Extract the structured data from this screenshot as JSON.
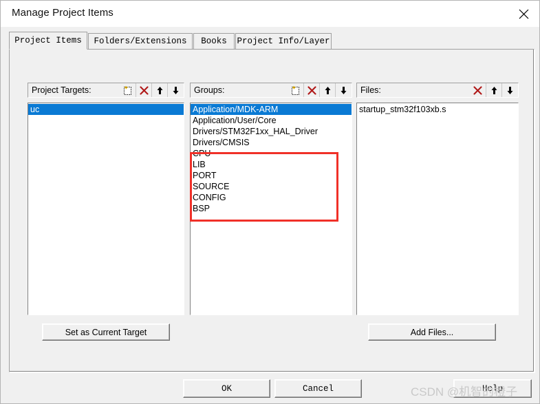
{
  "window": {
    "title": "Manage Project Items",
    "close_icon": "close-icon"
  },
  "tabs": [
    {
      "label": "Project Items",
      "active": true
    },
    {
      "label": "Folders/Extensions",
      "active": false
    },
    {
      "label": "Books",
      "active": false
    },
    {
      "label": "Project Info/Layer",
      "active": false
    }
  ],
  "panels": {
    "targets": {
      "header": "Project Targets:",
      "icons": [
        "new-item-icon",
        "delete-icon",
        "move-up-icon",
        "move-down-icon"
      ],
      "items": [
        {
          "label": "uc",
          "selected": true
        }
      ],
      "button": "Set as Current Target"
    },
    "groups": {
      "header": "Groups:",
      "icons": [
        "new-item-icon",
        "delete-icon",
        "move-up-icon",
        "move-down-icon"
      ],
      "items": [
        {
          "label": "Application/MDK-ARM",
          "selected": true
        },
        {
          "label": "Application/User/Core",
          "selected": false
        },
        {
          "label": "Drivers/STM32F1xx_HAL_Driver",
          "selected": false
        },
        {
          "label": "Drivers/CMSIS",
          "selected": false
        },
        {
          "label": "CPU",
          "selected": false
        },
        {
          "label": "LIB",
          "selected": false
        },
        {
          "label": "PORT",
          "selected": false
        },
        {
          "label": "SOURCE",
          "selected": false
        },
        {
          "label": "CONFIG",
          "selected": false
        },
        {
          "label": "BSP",
          "selected": false
        }
      ],
      "annotation": {
        "color": "#f03028",
        "first_index": 4,
        "last_index": 9
      }
    },
    "files": {
      "header": "Files:",
      "icons": [
        "delete-icon",
        "move-up-icon",
        "move-down-icon"
      ],
      "items": [
        {
          "label": "startup_stm32f103xb.s",
          "selected": false
        }
      ],
      "button": "Add Files..."
    }
  },
  "footer": {
    "ok": "OK",
    "cancel": "Cancel",
    "help": "Help"
  },
  "watermark": "CSDN @机智的橙子",
  "colors": {
    "selection": "#0a7ad4",
    "annotation": "#f03028",
    "face": "#f0f0f0",
    "delete_x": "#b01818"
  }
}
